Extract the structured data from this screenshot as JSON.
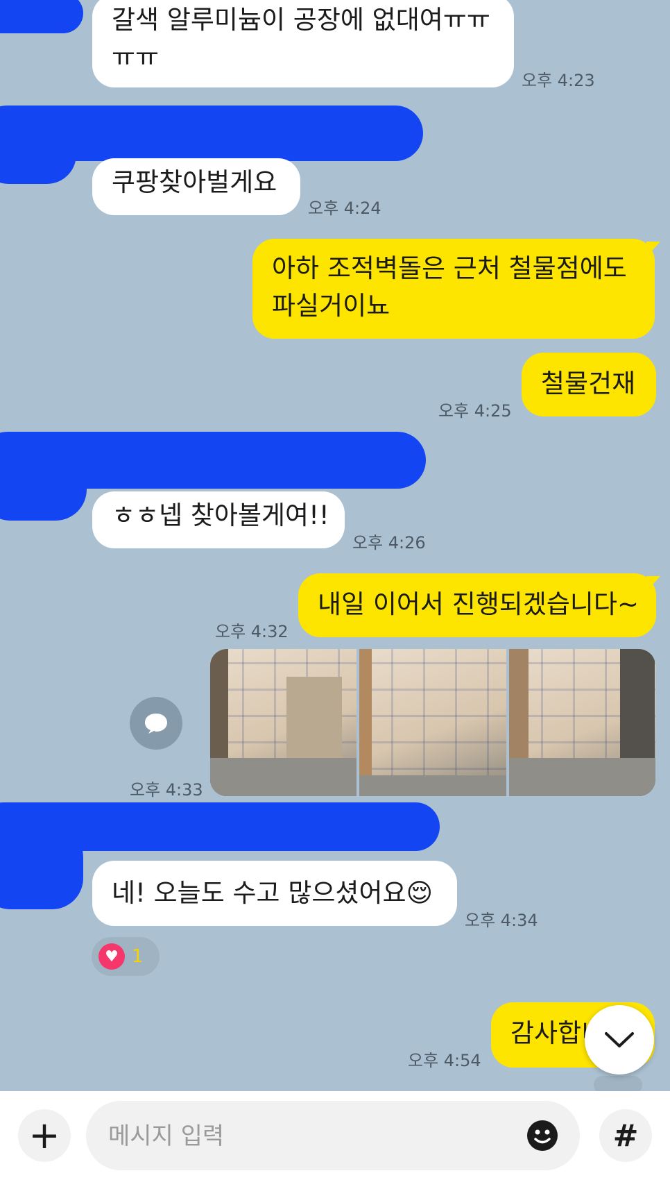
{
  "colors": {
    "background": "#abc1d1",
    "incoming_bubble": "#ffffff",
    "outgoing_bubble": "#fee500",
    "redaction": "#1346f2",
    "reaction_heart": "#f5376b"
  },
  "messages": [
    {
      "id": "m1",
      "direction": "incoming",
      "lines": [
        "갈색 알루미늄이 공장에 없대여ㅠㅠ",
        "ㅠㅠ"
      ],
      "time": "오후 4:23"
    },
    {
      "id": "m2",
      "direction": "incoming",
      "lines": [
        "쿠팡찾아벌게요"
      ],
      "time": "오후 4:24"
    },
    {
      "id": "m3",
      "direction": "outgoing",
      "lines": [
        "아하 조적벽돌은 근처 철물점에도",
        "파실거이뇨"
      ],
      "time": ""
    },
    {
      "id": "m4",
      "direction": "outgoing",
      "lines": [
        "철물건재"
      ],
      "time": "오후 4:25"
    },
    {
      "id": "m5",
      "direction": "incoming",
      "lines": [
        "ㅎㅎ넵 찾아볼게여!!"
      ],
      "time": "오후 4:26"
    },
    {
      "id": "m6",
      "direction": "outgoing",
      "lines": [
        "내일 이어서 진행되겠습니다~"
      ],
      "time": "오후 4:32"
    },
    {
      "id": "m7",
      "direction": "outgoing",
      "type": "photos",
      "photo_count": 3,
      "time": "오후 4:33"
    },
    {
      "id": "m8",
      "direction": "incoming",
      "lines": [
        "네! 오늘도 수고 많으셨어요😌"
      ],
      "time": "오후 4:34",
      "reaction": {
        "icon": "heart-icon",
        "count": "1"
      }
    },
    {
      "id": "m9",
      "direction": "outgoing",
      "lines": [
        "감사합니다"
      ],
      "time": "오후 4:54"
    }
  ],
  "input": {
    "placeholder": "메시지 입력",
    "plus_label": "+",
    "hash_label": "#",
    "emoji_icon": "smiley-icon"
  },
  "scroll_down_icon": "chevron-down-icon",
  "share_icon": "speech-bubble-icon"
}
